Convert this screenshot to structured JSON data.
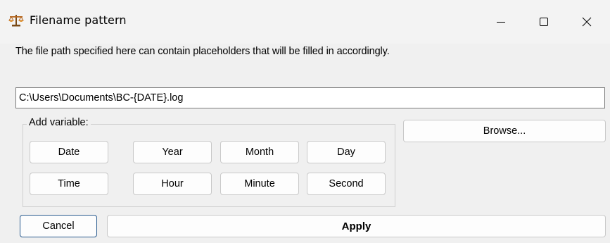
{
  "window": {
    "title": "Filename pattern",
    "icon": "scales-icon"
  },
  "description": "The file path specified here can contain placeholders that will be filled in accordingly.",
  "path_field": {
    "value": "C:\\Users\\Documents\\BC-{DATE}.log"
  },
  "variables": {
    "legend": "Add variable:",
    "buttons": [
      "Date",
      "Year",
      "Month",
      "Day",
      "Time",
      "Hour",
      "Minute",
      "Second"
    ]
  },
  "browse_label": "Browse...",
  "cancel_label": "Cancel",
  "apply_label": "Apply"
}
